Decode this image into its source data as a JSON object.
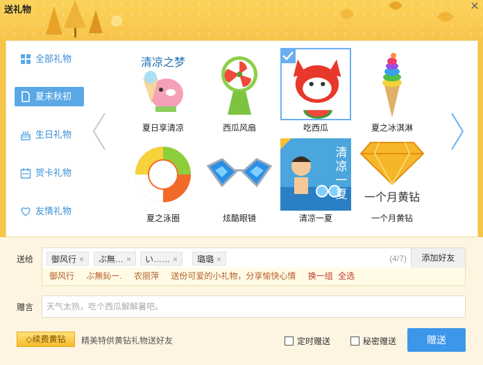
{
  "window": {
    "title": "送礼物"
  },
  "sidebar": {
    "items": [
      {
        "label": "全部礼物",
        "icon": "grid-icon",
        "active": false
      },
      {
        "label": "夏末秋初",
        "icon": "document-icon",
        "active": true
      },
      {
        "label": "生日礼物",
        "icon": "cake-icon",
        "active": false
      },
      {
        "label": "贺卡礼物",
        "icon": "calendar-icon",
        "active": false
      },
      {
        "label": "友情礼物",
        "icon": "heart-icon",
        "active": false
      }
    ]
  },
  "gifts": [
    {
      "name": "夏日享清凉",
      "overlay_text": "清凉之梦",
      "selected": false
    },
    {
      "name": "西瓜风扇",
      "selected": false
    },
    {
      "name": "吃西瓜",
      "selected": true
    },
    {
      "name": "夏之冰淇淋",
      "selected": false
    },
    {
      "name": "夏之泳圈",
      "selected": false
    },
    {
      "name": "炫酷眼镜",
      "selected": false
    },
    {
      "name": "清凉一夏",
      "overlay_text": [
        "清",
        "凉",
        "一",
        "夏"
      ],
      "selected": false
    },
    {
      "name": "一个月黄钻",
      "overlay_text": "一个月黄钻",
      "selected": false
    }
  ],
  "form": {
    "to_label": "送给",
    "recipients": [
      "御风行",
      "ぶ無…",
      "い……",
      "璐璐"
    ],
    "count": "(4/7)",
    "add_friend": "添加好友",
    "suggestions": [
      "御风行",
      "ぶ無鈊ー.",
      "农丽萍",
      "送份可爱的小礼物，分享愉快心情"
    ],
    "swap": "换一组",
    "select_all": "全选",
    "message_label": "赠言",
    "message_placeholder": "天气太热，吃个西瓜解解暑吧。",
    "vip_button": "续费黄钻",
    "vip_text": "精美特供黄钻礼物送好友",
    "scheduled": "定时赠送",
    "secret": "秘密赠送",
    "send": "赠送"
  },
  "colors": {
    "accent": "#3c96ea",
    "header": "#f7c44a",
    "sidebar_active": "#5aa8e6"
  }
}
